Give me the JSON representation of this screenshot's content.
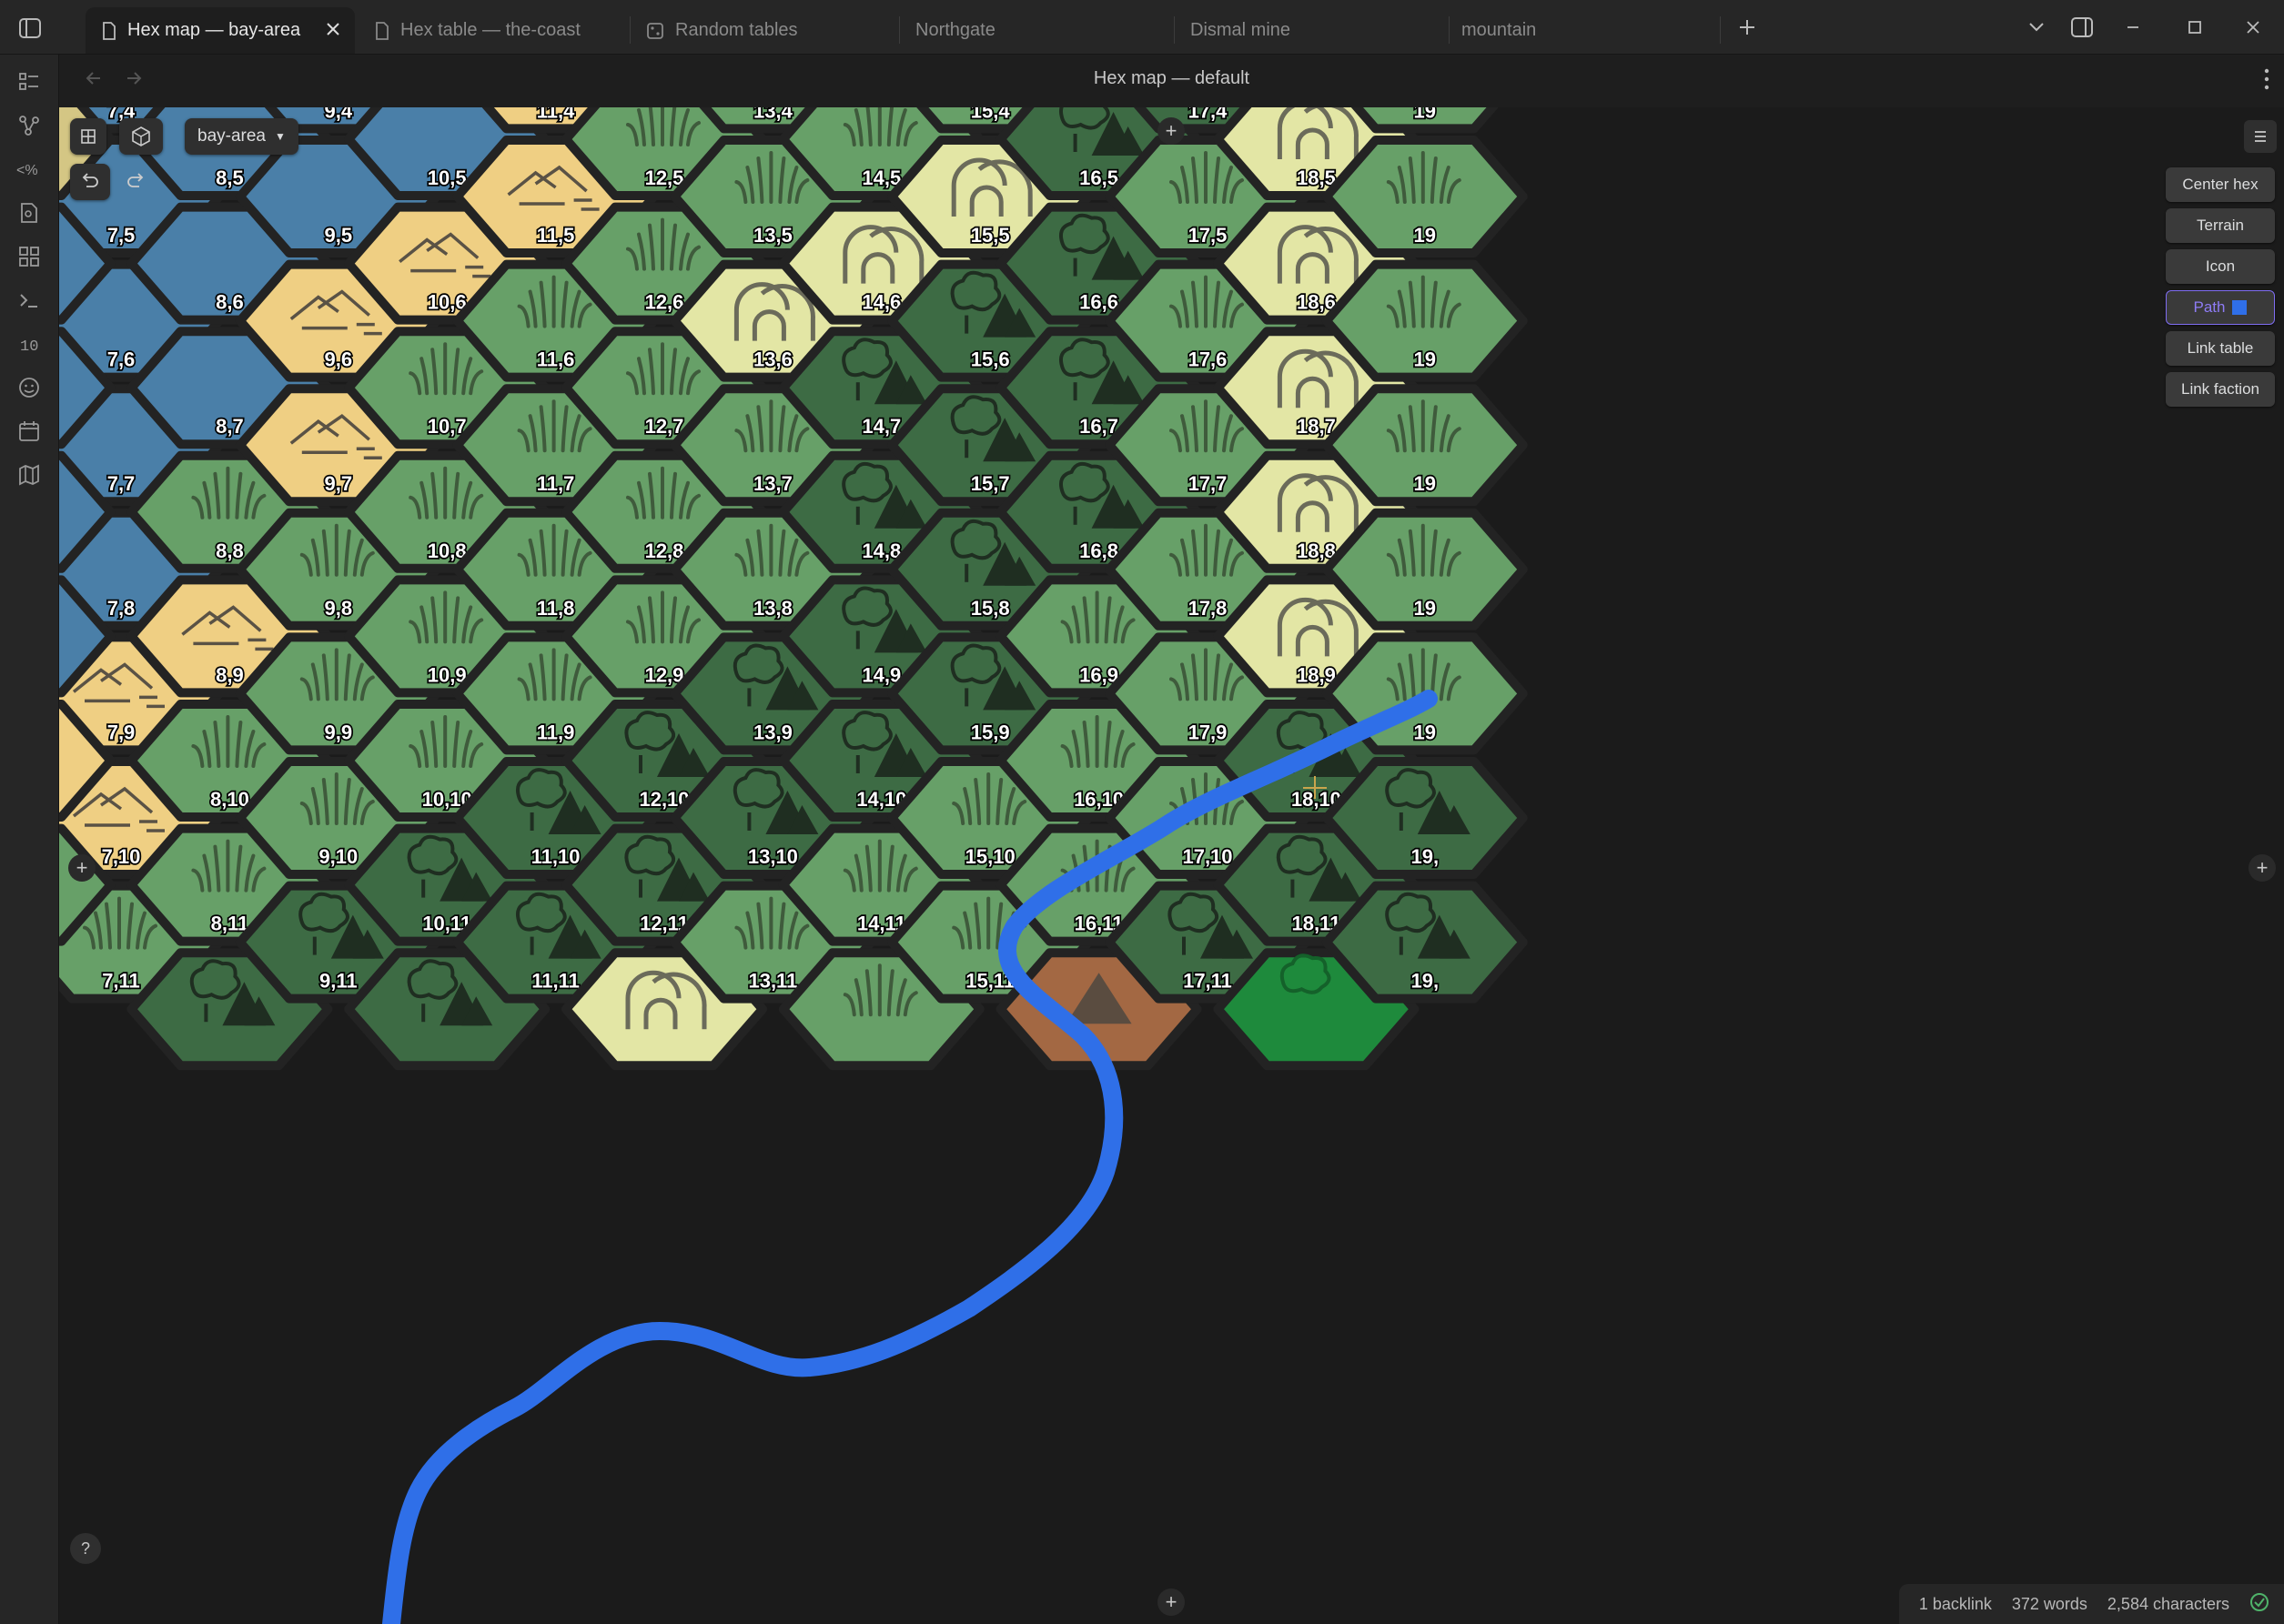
{
  "tabs": [
    {
      "label": "Hex map — bay-area",
      "icon": "file-icon",
      "active": true
    },
    {
      "label": "Hex table — the-coast",
      "icon": "file-icon",
      "active": false
    },
    {
      "label": "Random tables",
      "icon": "dice-table-icon",
      "active": false
    },
    {
      "label": "Northgate",
      "icon": "",
      "active": false
    },
    {
      "label": "Dismal mine",
      "icon": "",
      "active": false
    },
    {
      "label": "mountain",
      "icon": "",
      "active": false
    }
  ],
  "view_header": {
    "title": "Hex map — default"
  },
  "map": {
    "selected_map": "bay-area",
    "side_buttons": {
      "center_hex": "Center hex",
      "terrain": "Terrain",
      "icon": "Icon",
      "path": "Path",
      "link_table": "Link table",
      "link_faction": "Link faction"
    },
    "path_color": "#2f6fe8",
    "help": "?",
    "terrain_colors": {
      "water": "#4a7fa8",
      "hills": "#efcf83",
      "grass": "#67a068",
      "forest": "#3d6b44",
      "mountain_peaks": "#e3e6a5",
      "desert_partial": "#d4c684",
      "dirt": "#a36843",
      "bright_green": "#1e8a3c"
    },
    "hexes": [
      {
        "c": 7,
        "r": 4,
        "t": "water",
        "l": "7,4"
      },
      {
        "c": 7,
        "r": 5,
        "t": "water",
        "l": "7,5"
      },
      {
        "c": 7,
        "r": 6,
        "t": "water",
        "l": "7,6"
      },
      {
        "c": 7,
        "r": 7,
        "t": "water",
        "l": "7,7"
      },
      {
        "c": 7,
        "r": 8,
        "t": "water",
        "l": "7,8"
      },
      {
        "c": 7,
        "r": 9,
        "t": "hills",
        "l": "7,9"
      },
      {
        "c": 7,
        "r": 10,
        "t": "hills",
        "l": "7,10"
      },
      {
        "c": 7,
        "r": 11,
        "t": "grass",
        "l": "7,11"
      },
      {
        "c": 8,
        "r": 4,
        "t": "water",
        "l": ""
      },
      {
        "c": 8,
        "r": 5,
        "t": "water",
        "l": "8,5"
      },
      {
        "c": 8,
        "r": 6,
        "t": "water",
        "l": "8,6"
      },
      {
        "c": 8,
        "r": 7,
        "t": "water",
        "l": "8,7"
      },
      {
        "c": 8,
        "r": 8,
        "t": "grass",
        "l": "8,8"
      },
      {
        "c": 8,
        "r": 9,
        "t": "hills",
        "l": "8,9"
      },
      {
        "c": 8,
        "r": 10,
        "t": "grass",
        "l": "8,10"
      },
      {
        "c": 8,
        "r": 11,
        "t": "grass",
        "l": "8,11"
      },
      {
        "c": 8,
        "r": 12,
        "t": "forest",
        "l": ""
      },
      {
        "c": 9,
        "r": 4,
        "t": "water",
        "l": "9,4"
      },
      {
        "c": 9,
        "r": 5,
        "t": "water",
        "l": "9,5"
      },
      {
        "c": 9,
        "r": 6,
        "t": "hills",
        "l": "9,6"
      },
      {
        "c": 9,
        "r": 7,
        "t": "hills",
        "l": "9,7"
      },
      {
        "c": 9,
        "r": 8,
        "t": "grass",
        "l": "9,8"
      },
      {
        "c": 9,
        "r": 9,
        "t": "grass",
        "l": "9,9"
      },
      {
        "c": 9,
        "r": 10,
        "t": "grass",
        "l": "9,10"
      },
      {
        "c": 9,
        "r": 11,
        "t": "forest",
        "l": "9,11"
      },
      {
        "c": 10,
        "r": 4,
        "t": "water",
        "l": ""
      },
      {
        "c": 10,
        "r": 5,
        "t": "water",
        "l": "10,5"
      },
      {
        "c": 10,
        "r": 6,
        "t": "hills",
        "l": "10,6"
      },
      {
        "c": 10,
        "r": 7,
        "t": "grass",
        "l": "10,7"
      },
      {
        "c": 10,
        "r": 8,
        "t": "grass",
        "l": "10,8"
      },
      {
        "c": 10,
        "r": 9,
        "t": "grass",
        "l": "10,9"
      },
      {
        "c": 10,
        "r": 10,
        "t": "grass",
        "l": "10,10"
      },
      {
        "c": 10,
        "r": 11,
        "t": "forest",
        "l": "10,11"
      },
      {
        "c": 10,
        "r": 12,
        "t": "forest",
        "l": ""
      },
      {
        "c": 11,
        "r": 4,
        "t": "hills",
        "l": "11,4"
      },
      {
        "c": 11,
        "r": 5,
        "t": "hills",
        "l": "11,5"
      },
      {
        "c": 11,
        "r": 6,
        "t": "grass",
        "l": "11,6"
      },
      {
        "c": 11,
        "r": 7,
        "t": "grass",
        "l": "11,7"
      },
      {
        "c": 11,
        "r": 8,
        "t": "grass",
        "l": "11,8"
      },
      {
        "c": 11,
        "r": 9,
        "t": "grass",
        "l": "11,9"
      },
      {
        "c": 11,
        "r": 10,
        "t": "forest",
        "l": "11,10"
      },
      {
        "c": 11,
        "r": 11,
        "t": "forest",
        "l": "11,11"
      },
      {
        "c": 12,
        "r": 4,
        "t": "grass",
        "l": ""
      },
      {
        "c": 12,
        "r": 5,
        "t": "grass",
        "l": "12,5"
      },
      {
        "c": 12,
        "r": 6,
        "t": "grass",
        "l": "12,6"
      },
      {
        "c": 12,
        "r": 7,
        "t": "grass",
        "l": "12,7"
      },
      {
        "c": 12,
        "r": 8,
        "t": "grass",
        "l": "12,8"
      },
      {
        "c": 12,
        "r": 9,
        "t": "grass",
        "l": "12,9"
      },
      {
        "c": 12,
        "r": 10,
        "t": "forest",
        "l": "12,10"
      },
      {
        "c": 12,
        "r": 11,
        "t": "forest",
        "l": "12,11"
      },
      {
        "c": 12,
        "r": 12,
        "t": "mountain_peaks",
        "l": ""
      },
      {
        "c": 13,
        "r": 4,
        "t": "grass",
        "l": "13,4"
      },
      {
        "c": 13,
        "r": 5,
        "t": "grass",
        "l": "13,5"
      },
      {
        "c": 13,
        "r": 6,
        "t": "mountain_peaks",
        "l": "13,6"
      },
      {
        "c": 13,
        "r": 7,
        "t": "grass",
        "l": "13,7"
      },
      {
        "c": 13,
        "r": 8,
        "t": "grass",
        "l": "13,8"
      },
      {
        "c": 13,
        "r": 9,
        "t": "forest",
        "l": "13,9"
      },
      {
        "c": 13,
        "r": 10,
        "t": "forest",
        "l": "13,10"
      },
      {
        "c": 13,
        "r": 11,
        "t": "grass",
        "l": "13,11"
      },
      {
        "c": 14,
        "r": 4,
        "t": "grass",
        "l": ""
      },
      {
        "c": 14,
        "r": 5,
        "t": "grass",
        "l": "14,5"
      },
      {
        "c": 14,
        "r": 6,
        "t": "mountain_peaks",
        "l": "14,6"
      },
      {
        "c": 14,
        "r": 7,
        "t": "forest",
        "l": "14,7"
      },
      {
        "c": 14,
        "r": 8,
        "t": "forest",
        "l": "14,8"
      },
      {
        "c": 14,
        "r": 9,
        "t": "forest",
        "l": "14,9"
      },
      {
        "c": 14,
        "r": 10,
        "t": "forest",
        "l": "14,10"
      },
      {
        "c": 14,
        "r": 11,
        "t": "grass",
        "l": "14,11"
      },
      {
        "c": 14,
        "r": 12,
        "t": "grass",
        "l": ""
      },
      {
        "c": 15,
        "r": 4,
        "t": "grass",
        "l": "15,4"
      },
      {
        "c": 15,
        "r": 5,
        "t": "mountain_peaks",
        "l": "15,5"
      },
      {
        "c": 15,
        "r": 6,
        "t": "forest",
        "l": "15,6"
      },
      {
        "c": 15,
        "r": 7,
        "t": "forest",
        "l": "15,7"
      },
      {
        "c": 15,
        "r": 8,
        "t": "forest",
        "l": "15,8"
      },
      {
        "c": 15,
        "r": 9,
        "t": "forest",
        "l": "15,9"
      },
      {
        "c": 15,
        "r": 10,
        "t": "grass",
        "l": "15,10"
      },
      {
        "c": 15,
        "r": 11,
        "t": "grass",
        "l": "15,11"
      },
      {
        "c": 16,
        "r": 4,
        "t": "forest",
        "l": ""
      },
      {
        "c": 16,
        "r": 5,
        "t": "forest",
        "l": "16,5"
      },
      {
        "c": 16,
        "r": 6,
        "t": "forest",
        "l": "16,6"
      },
      {
        "c": 16,
        "r": 7,
        "t": "forest",
        "l": "16,7"
      },
      {
        "c": 16,
        "r": 8,
        "t": "forest",
        "l": "16,8"
      },
      {
        "c": 16,
        "r": 9,
        "t": "grass",
        "l": "16,9"
      },
      {
        "c": 16,
        "r": 10,
        "t": "grass",
        "l": "16,10"
      },
      {
        "c": 16,
        "r": 11,
        "t": "grass",
        "l": "16,11"
      },
      {
        "c": 16,
        "r": 12,
        "t": "dirt",
        "l": ""
      },
      {
        "c": 17,
        "r": 4,
        "t": "forest",
        "l": "17,4"
      },
      {
        "c": 17,
        "r": 5,
        "t": "grass",
        "l": "17,5"
      },
      {
        "c": 17,
        "r": 6,
        "t": "grass",
        "l": "17,6"
      },
      {
        "c": 17,
        "r": 7,
        "t": "grass",
        "l": "17,7"
      },
      {
        "c": 17,
        "r": 8,
        "t": "grass",
        "l": "17,8"
      },
      {
        "c": 17,
        "r": 9,
        "t": "grass",
        "l": "17,9"
      },
      {
        "c": 17,
        "r": 10,
        "t": "grass",
        "l": "17,10"
      },
      {
        "c": 17,
        "r": 11,
        "t": "forest",
        "l": "17,11"
      },
      {
        "c": 18,
        "r": 4,
        "t": "mountain_peaks",
        "l": ""
      },
      {
        "c": 18,
        "r": 5,
        "t": "mountain_peaks",
        "l": "18,5"
      },
      {
        "c": 18,
        "r": 6,
        "t": "mountain_peaks",
        "l": "18,6"
      },
      {
        "c": 18,
        "r": 7,
        "t": "mountain_peaks",
        "l": "18,7"
      },
      {
        "c": 18,
        "r": 8,
        "t": "mountain_peaks",
        "l": "18,8"
      },
      {
        "c": 18,
        "r": 9,
        "t": "mountain_peaks",
        "l": "18,9"
      },
      {
        "c": 18,
        "r": 10,
        "t": "forest",
        "l": "18,10"
      },
      {
        "c": 18,
        "r": 11,
        "t": "forest",
        "l": "18,11"
      },
      {
        "c": 18,
        "r": 12,
        "t": "bright_green",
        "l": ""
      },
      {
        "c": 19,
        "r": 4,
        "t": "grass",
        "l": "19"
      },
      {
        "c": 19,
        "r": 5,
        "t": "grass",
        "l": "19"
      },
      {
        "c": 19,
        "r": 6,
        "t": "grass",
        "l": "19"
      },
      {
        "c": 19,
        "r": 7,
        "t": "grass",
        "l": "19"
      },
      {
        "c": 19,
        "r": 8,
        "t": "grass",
        "l": "19"
      },
      {
        "c": 19,
        "r": 9,
        "t": "grass",
        "l": "19"
      },
      {
        "c": 19,
        "r": 10,
        "t": "forest",
        "l": "19,"
      },
      {
        "c": 19,
        "r": 11,
        "t": "forest",
        "l": "19,"
      },
      {
        "c": 6,
        "r": 4,
        "t": "desert_partial",
        "l": ""
      },
      {
        "c": 6,
        "r": 5,
        "t": "desert_partial",
        "l": ""
      },
      {
        "c": 6,
        "r": 6,
        "t": "water",
        "l": ""
      },
      {
        "c": 6,
        "r": 7,
        "t": "water",
        "l": ""
      },
      {
        "c": 6,
        "r": 8,
        "t": "water",
        "l": ""
      },
      {
        "c": 6,
        "r": 9,
        "t": "water",
        "l": ""
      },
      {
        "c": 6,
        "r": 10,
        "t": "hills",
        "l": ""
      },
      {
        "c": 6,
        "r": 11,
        "t": "grass",
        "l": ""
      }
    ]
  },
  "status_bar": {
    "backlinks": "1 backlink",
    "words": "372 words",
    "characters": "2,584 characters"
  }
}
